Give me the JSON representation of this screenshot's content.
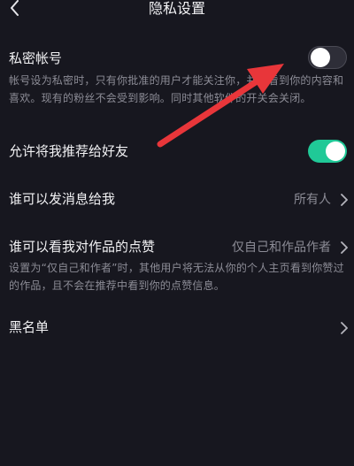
{
  "header": {
    "title": "隐私设置"
  },
  "settings": {
    "private_account": {
      "label": "私密帐号",
      "desc": "帐号设为私密时，只有你批准的用户才能关注你，并能看到你的内容和喜欢。现有的粉丝不会受到影响。同时其他软件的开关会关闭。",
      "enabled": false
    },
    "recommend_to_friends": {
      "label": "允许将我推荐给好友",
      "enabled": true
    },
    "who_can_message": {
      "label": "谁可以发消息给我",
      "value": "所有人"
    },
    "who_can_see_likes": {
      "label": "谁可以看我对作品的点赞",
      "value": "仅自己和作品作者",
      "desc": "设置为“仅自己和作者”时，其他用户将无法从你的个人主页看到你赞过的作品，且不会在推荐中看到你的点赞信息。"
    },
    "blacklist": {
      "label": "黑名单"
    }
  },
  "colors": {
    "background": "#17171f",
    "toggle_on": "#20c997",
    "arrow": "#e8363a"
  },
  "icons": {
    "back": "chevron-left-icon",
    "row_chevron": "chevron-right-icon",
    "annotation": "arrow-icon"
  }
}
